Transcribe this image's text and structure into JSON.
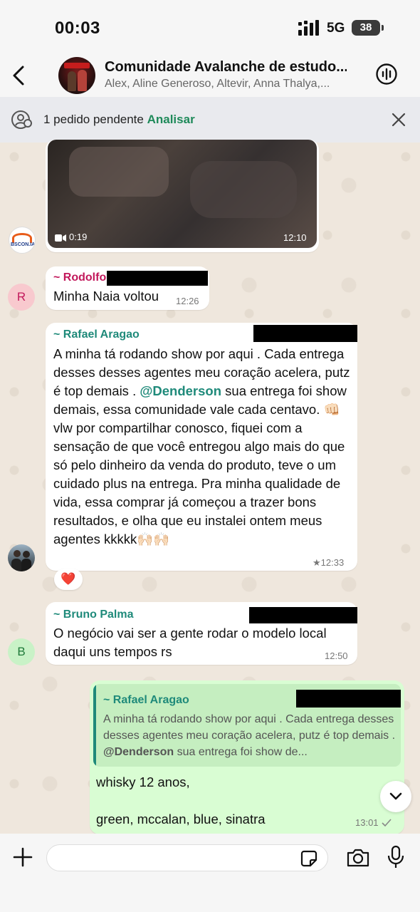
{
  "status_bar": {
    "time": "00:03",
    "network": "5G",
    "battery": "38"
  },
  "header": {
    "title": "Comunidade Avalanche de estudo...",
    "members": "Alex, Aline Generoso, Altevir, Anna Thalya,..."
  },
  "pending": {
    "text": "1 pedido pendente ",
    "link": "Analisar"
  },
  "video": {
    "duration": "0:19",
    "time": "12:10",
    "sender_avatar_text": "BSCON.IA"
  },
  "messages": [
    {
      "sender": "~ Rodolfo",
      "text": "Minha Naia voltou",
      "time": "12:26",
      "avatar": "R"
    },
    {
      "sender": "~ Rafael Aragao",
      "text_before_mention": "A minha tá rodando show por aqui . Cada entrega desses desses agentes meu coração acelera, putz é top demais . ",
      "mention": "@Denderson",
      "text_after_mention": " sua entrega foi show demais, essa comunidade vale cada centavo. 👊🏻vlw por compartilhar conosco, fiquei com a sensação de que você entregou algo mais do que só pelo dinheiro da venda do produto, teve o um cuidado plus na entrega. Pra minha qualidade de vida, essa comprar já começou a trazer bons resultados, e olha que eu instalei ontem meus agentes kkkkk🙌🏻🙌🏻",
      "time": "★12:33",
      "reaction": "❤️"
    },
    {
      "sender": "~ Bruno Palma",
      "text": "O negócio vai ser a gente rodar o modelo local daqui uns tempos rs",
      "time": "12:50",
      "avatar": "B"
    }
  ],
  "outgoing": {
    "quote_sender": "~ Rafael Aragao",
    "quote_before_mention": "A minha tá rodando show por aqui . Cada entrega desses desses agentes meu coração acelera, putz é top demais . ",
    "quote_mention": "@Denderson",
    "quote_after_mention": " sua entrega foi show de...",
    "line1": "whisky 12 anos,",
    "line2": "green, mccalan, blue, sinatra",
    "time": "13:01"
  },
  "colors": {
    "accent_green": "#1f8a5a",
    "rodolfo": "#c2185b",
    "rafael": "#1f8a7a",
    "bruno": "#1f8a7a",
    "outgoing_bg": "#d9fdd3"
  },
  "icons": {
    "back": "chevron-left-icon",
    "voice_chat": "audio-wave-icon",
    "add": "plus-icon",
    "sticker": "sticker-icon",
    "camera": "camera-icon",
    "mic": "microphone-icon",
    "scroll_down": "chevron-down-icon"
  }
}
